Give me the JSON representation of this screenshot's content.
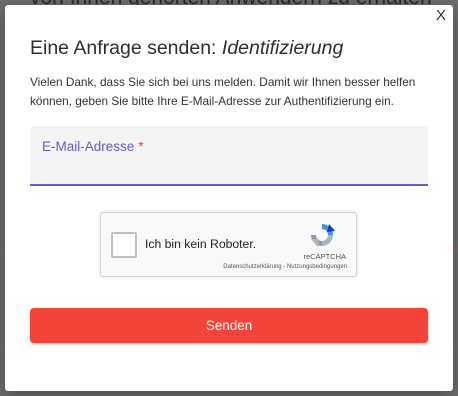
{
  "background": {
    "heading_fragment": "von Ihnen gehörten Anwendern zu erhalten"
  },
  "modal": {
    "close_label": "X",
    "title_prefix": "Eine Anfrage senden: ",
    "title_emphasis": "Identifizierung",
    "description": "Vielen Dank, dass Sie sich bei uns melden. Damit wir Ihnen besser helfen können, geben Sie bitte Ihre E-Mail-Adresse zur Authentifizierung ein.",
    "email": {
      "label": "E-Mail-Adresse",
      "required_mark": "*",
      "value": ""
    },
    "captcha": {
      "label": "Ich bin kein Roboter.",
      "brand": "reCAPTCHA",
      "links": "Datenschutzerklärung - Nutzungsbedingungen"
    },
    "submit_label": "Senden"
  },
  "colors": {
    "accent": "#6e59c4",
    "submit": "#f4443a",
    "required": "#e3453d"
  }
}
